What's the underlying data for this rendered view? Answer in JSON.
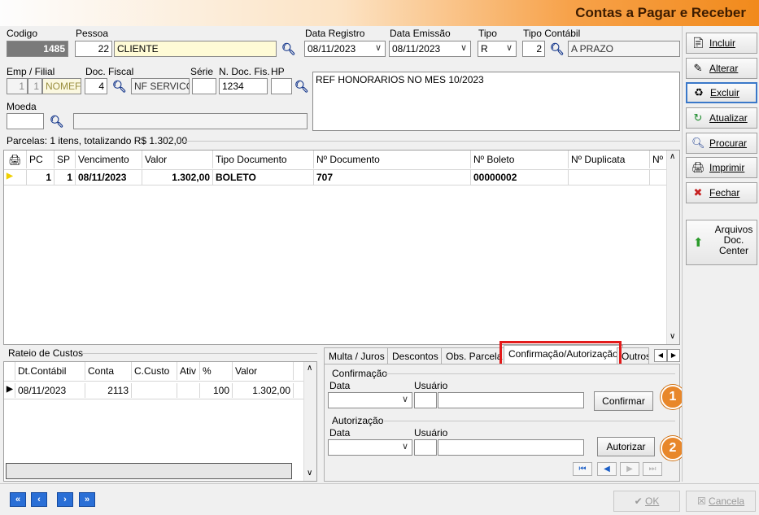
{
  "window_title": "Contas a Pagar e Receber",
  "header": {
    "codigo_label": "Codigo",
    "codigo_value": "1485",
    "pessoa_label": "Pessoa",
    "pessoa_code": "22",
    "pessoa_name": "CLIENTE",
    "data_registro_label": "Data Registro",
    "data_registro_value": "08/11/2023",
    "data_emissao_label": "Data Emissão",
    "data_emissao_value": "08/11/2023",
    "tipo_label": "Tipo",
    "tipo_value": "R",
    "tipo_contabil_label": "Tipo Contábil",
    "tipo_contabil_code": "2",
    "tipo_contabil_name": "A PRAZO",
    "emp_filial_label": "Emp / Filial",
    "emp_value": "1",
    "filial_value": "1",
    "filial_name": "NOMEFA",
    "doc_fiscal_label": "Doc. Fiscal",
    "doc_fiscal_code": "4",
    "doc_fiscal_name": "NF SERVICO",
    "serie_label": "Série",
    "serie_value": "",
    "n_doc_fis_label": "N. Doc. Fis.",
    "n_doc_fis_value": "1234",
    "hp_label": "HP",
    "hp_value": "",
    "historico_value": "REF HONORARIOS NO MES 10/2023",
    "moeda_label": "Moeda",
    "moeda_value": ""
  },
  "parcelas": {
    "caption": "Parcelas: 1 itens, totalizando R$ 1.302,00",
    "columns": [
      "PC",
      "SP",
      "Vencimento",
      "Valor",
      "Tipo Documento",
      "Nº Documento",
      "Nº Boleto",
      "Nº Duplicata",
      "Nº"
    ],
    "rows": [
      {
        "pc": "1",
        "sp": "1",
        "vencimento": "08/11/2023",
        "valor": "1.302,00",
        "tipo_documento": "BOLETO",
        "n_documento": "707",
        "n_boleto": "00000002",
        "n_duplicata": "",
        "n": ""
      }
    ]
  },
  "rateio": {
    "caption": "Rateio de Custos",
    "columns": [
      "Dt.Contábil",
      "Conta",
      "C.Custo",
      "Ativ",
      "%",
      "Valor"
    ],
    "rows": [
      {
        "dt_contabil": "08/11/2023",
        "conta": "2113",
        "c_custo": "",
        "ativ": "",
        "pct": "100",
        "valor": "1.302,00"
      }
    ]
  },
  "tabs": [
    "Multa / Juros",
    "Descontos",
    "Obs. Parcela",
    "Confirmação/Autorização",
    "Outros"
  ],
  "confirmacao": {
    "group_label": "Confirmação",
    "data_label": "Data",
    "usuario_label": "Usuário",
    "button_label": "Confirmar",
    "badge": "1"
  },
  "autorizacao": {
    "group_label": "Autorização",
    "data_label": "Data",
    "usuario_label": "Usuário",
    "button_label": "Autorizar",
    "badge": "2"
  },
  "sidebar": {
    "incluir": "Incluir",
    "alterar": "Alterar",
    "excluir": "Excluir",
    "atualizar": "Atualizar",
    "procurar": "Procurar",
    "imprimir": "Imprimir",
    "fechar": "Fechar",
    "arquivos_line1": "Arquivos",
    "arquivos_line2": "Doc.",
    "arquivos_line3": "Center"
  },
  "footer": {
    "ok_label": "OK",
    "cancela_label": "Cancela"
  },
  "colors": {
    "highlight_red": "#e31b1b",
    "badge_orange": "#e8872a",
    "nav_blue": "#2a6fd6"
  }
}
